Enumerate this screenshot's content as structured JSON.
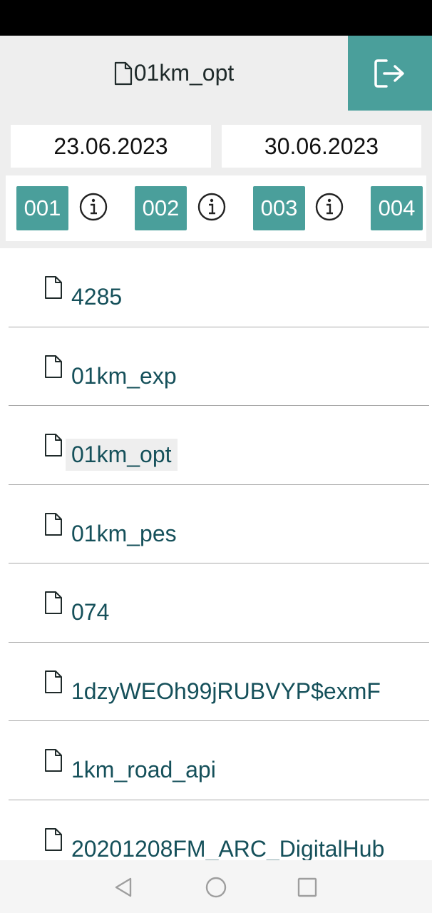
{
  "header": {
    "title": "01km_opt",
    "title_icon": "file-icon",
    "action_icon": "logout-icon"
  },
  "filters": {
    "date_from": "23.06.2023",
    "date_to": "30.06.2023",
    "chips": [
      "001",
      "002",
      "003",
      "004"
    ]
  },
  "files": [
    "4285",
    "01km_exp",
    "01km_opt",
    "01km_pes",
    "074",
    "1dzyWEOh99jRUBVYP$exmF",
    "1km_road_api",
    "20201208FM_ARC_DigitalHub"
  ],
  "selected_file": "01km_opt",
  "colors": {
    "accent": "#4a9f9b",
    "header_bg": "#eeeeee",
    "file_text": "#15505a"
  }
}
